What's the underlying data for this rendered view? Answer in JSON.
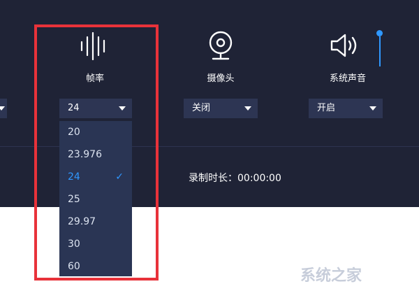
{
  "settings": {
    "framerate": {
      "label": "帧率",
      "value": "24",
      "icon": "audio-wave-icon"
    },
    "camera": {
      "label": "摄像头",
      "value": "关闭",
      "icon": "webcam-icon"
    },
    "system_audio": {
      "label": "系统声音",
      "value": "开启",
      "icon": "speaker-icon"
    }
  },
  "dropdown": {
    "options": [
      "20",
      "23.976",
      "24",
      "25",
      "29.97",
      "30",
      "60"
    ],
    "selected": "24",
    "check": "✓"
  },
  "recording": {
    "duration_text": "录制时长：00:00:00"
  },
  "watermark": {
    "text": "系统之家"
  },
  "colors": {
    "panel_bg": "#1f2336",
    "select_bg": "#2d3553",
    "accent": "#2f98ff",
    "highlight_box": "#e8323a"
  }
}
